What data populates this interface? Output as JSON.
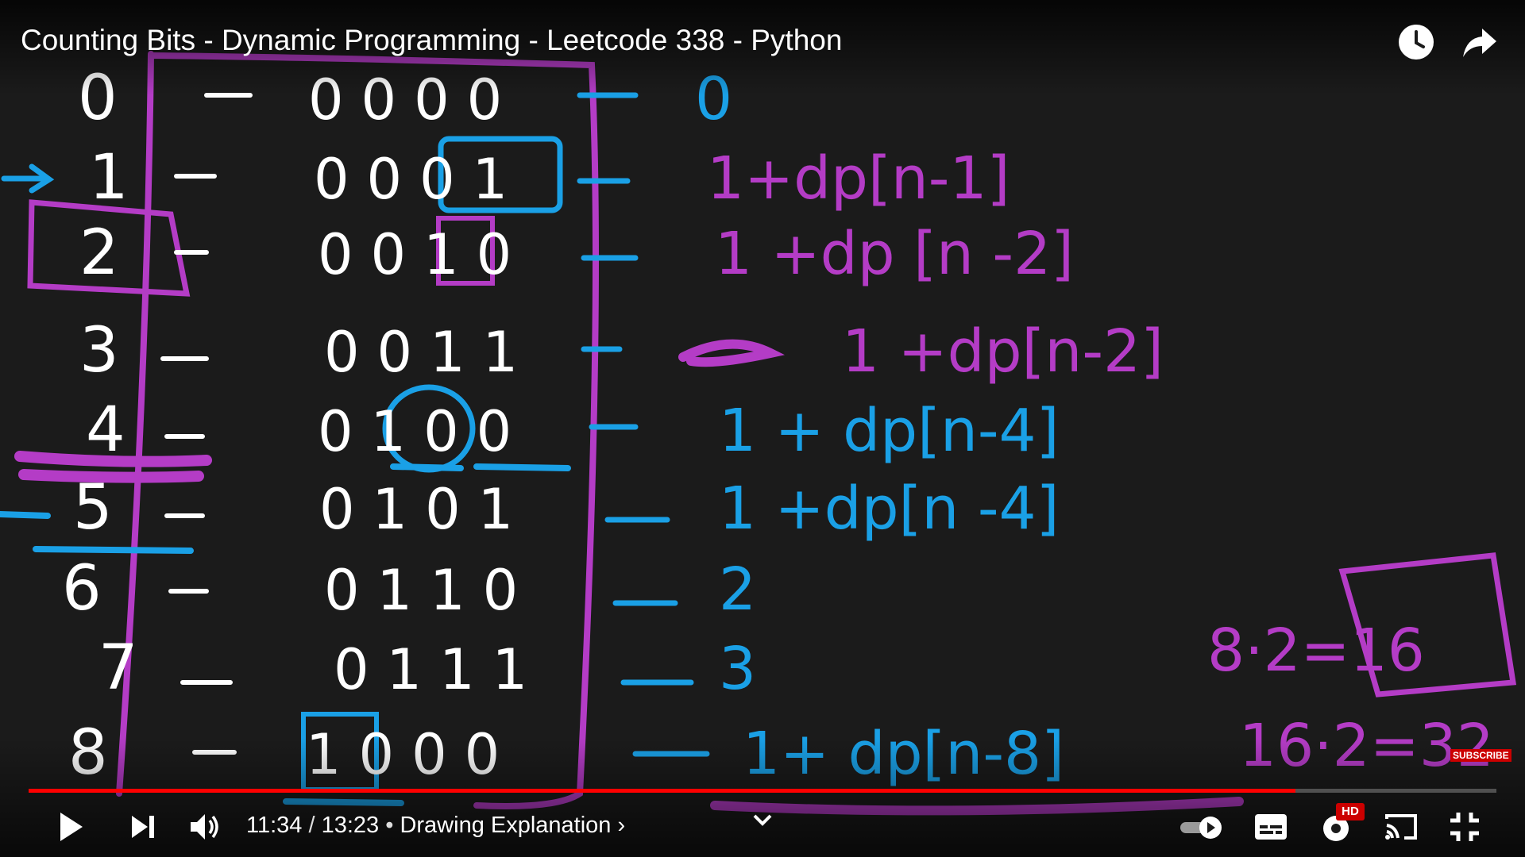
{
  "video": {
    "title": "Counting Bits - Dynamic Programming - Leetcode 338 - Python",
    "watch_later_icon": "clock-icon",
    "share_icon": "share-arrow-icon"
  },
  "board": {
    "rows": [
      {
        "n": "0",
        "bits": "0000",
        "result": "0"
      },
      {
        "n": "1",
        "bits": "0001",
        "result": "1+dp[n-1]"
      },
      {
        "n": "2",
        "bits": "0010",
        "result": "1 +dp [n -2]"
      },
      {
        "n": "3",
        "bits": "0011",
        "result": "1 +dp[n-2]"
      },
      {
        "n": "4",
        "bits": "0100",
        "result": "1 + dp[n-4]"
      },
      {
        "n": "5",
        "bits": "0101",
        "result": "1 +dp[n -4]"
      },
      {
        "n": "6",
        "bits": "0110",
        "result": "2"
      },
      {
        "n": "7",
        "bits": "0111",
        "result": "3"
      },
      {
        "n": "8",
        "bits": "1000",
        "result": "1+ dp[n-8]"
      }
    ],
    "side_note_1": "8·2=16",
    "side_note_2": "16·2=32",
    "colors": {
      "white": "#ffffff",
      "blue": "#1aa0e6",
      "purple": "#b43cc6",
      "background": "#1b1b1b"
    }
  },
  "player": {
    "current_time": "11:34",
    "duration": "13:23",
    "time_separator": " / ",
    "chapter_bullet": " • ",
    "chapter": "Drawing Explanation ›",
    "progress": 0.863,
    "subscribe_watermark": "SUBSCRIBE",
    "hd_badge": "HD",
    "accent": "#ff0000",
    "icons": [
      "play-icon",
      "next-icon",
      "volume-icon",
      "chevron-down-icon",
      "autoplay-toggle-icon",
      "subtitles-icon",
      "settings-icon",
      "cast-icon",
      "exit-fullscreen-icon"
    ]
  }
}
